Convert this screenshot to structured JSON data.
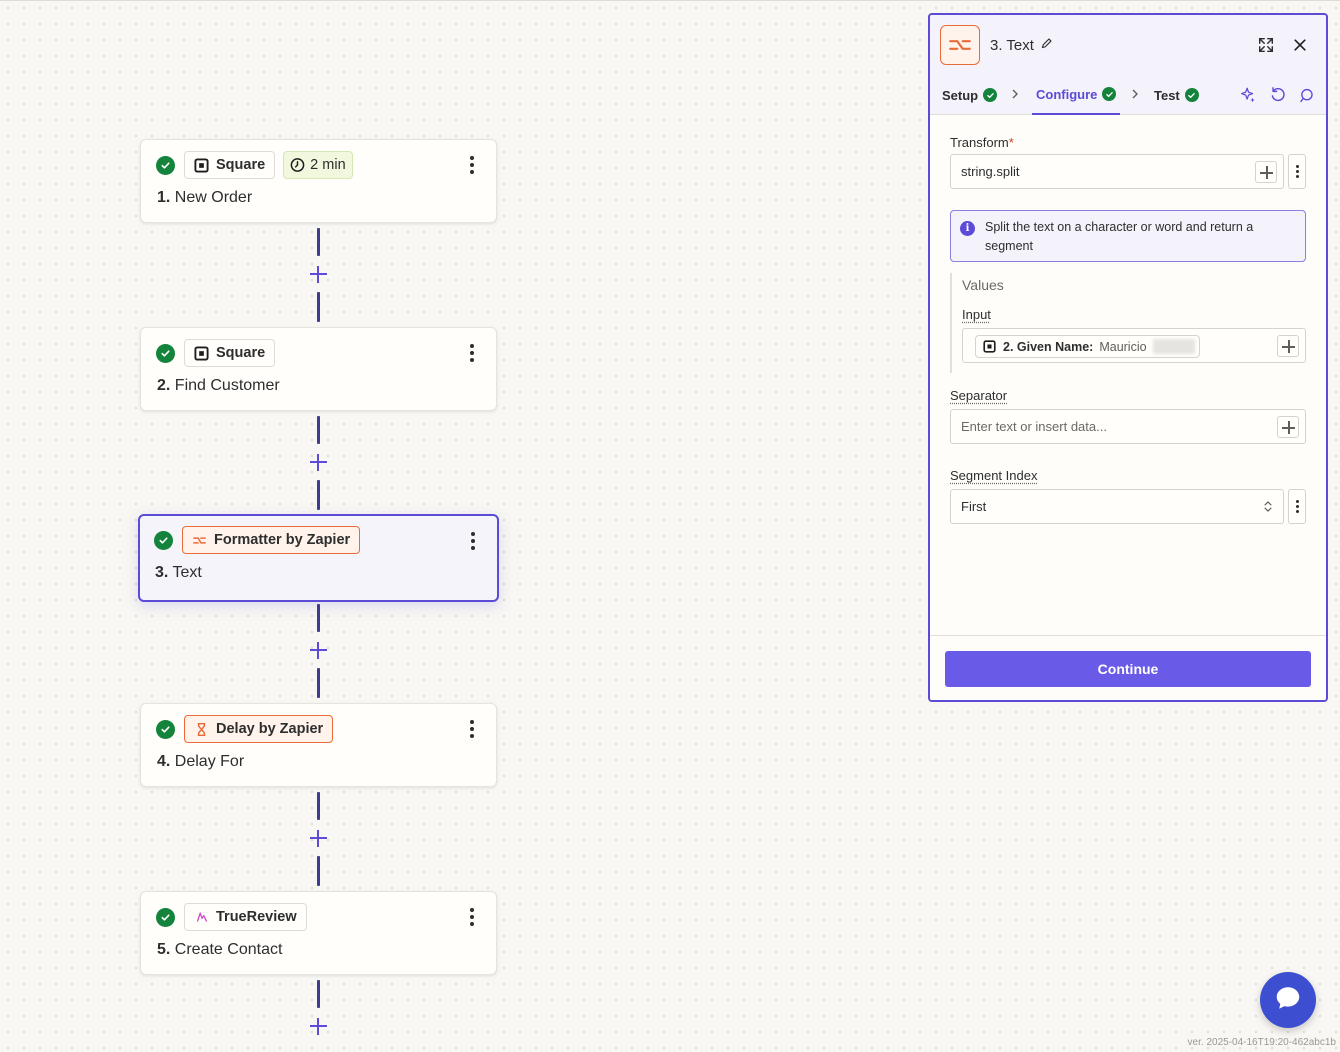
{
  "steps": [
    {
      "app": "Square",
      "badge": "2 min",
      "number": "1.",
      "title": "New Order"
    },
    {
      "app": "Square",
      "number": "2.",
      "title": "Find Customer"
    },
    {
      "app": "Formatter by Zapier",
      "number": "3.",
      "title": "Text"
    },
    {
      "app": "Delay by Zapier",
      "number": "4.",
      "title": "Delay For"
    },
    {
      "app": "TrueReview",
      "number": "5.",
      "title": "Create Contact"
    }
  ],
  "panel": {
    "title": "3. Text",
    "tabs": [
      {
        "label": "Setup"
      },
      {
        "label": "Configure"
      },
      {
        "label": "Test"
      }
    ],
    "transform": {
      "label": "Transform",
      "required": "*",
      "value": "string.split"
    },
    "info": "Split the text on a character or word and return a segment",
    "values": {
      "heading": "Values",
      "input_label": "Input",
      "pill_label": "2. Given Name:",
      "pill_value": "Mauricio"
    },
    "separator": {
      "label": "Separator",
      "placeholder": "Enter text or insert data..."
    },
    "segment_index": {
      "label": "Segment Index",
      "value": "First"
    },
    "continue_label": "Continue"
  },
  "colors": {
    "accent": "#5b4bd6",
    "success": "#14833b",
    "formatter_orange": "#ea6b37",
    "continue": "#695be8",
    "chat": "#3d4ed1"
  },
  "icons": {
    "square": "square-app-icon",
    "formatter": "formatter-icon",
    "delay": "hourglass-icon",
    "truereview": "truereview-icon",
    "timer": "clock-icon",
    "chat": "chat-icon"
  },
  "version": "ver. 2025-04-16T19:20-462abc1b"
}
